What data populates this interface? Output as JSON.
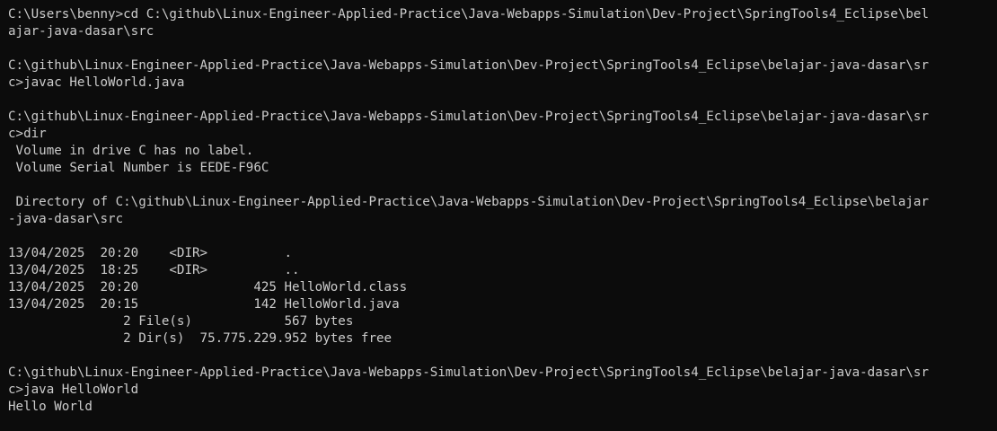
{
  "terminal": {
    "foreground": "#cccccc",
    "background": "#0c0c0c",
    "lines": [
      "C:\\Users\\benny>cd C:\\github\\Linux-Engineer-Applied-Practice\\Java-Webapps-Simulation\\Dev-Project\\SpringTools4_Eclipse\\bel",
      "ajar-java-dasar\\src",
      "",
      "C:\\github\\Linux-Engineer-Applied-Practice\\Java-Webapps-Simulation\\Dev-Project\\SpringTools4_Eclipse\\belajar-java-dasar\\sr",
      "c>javac HelloWorld.java",
      "",
      "C:\\github\\Linux-Engineer-Applied-Practice\\Java-Webapps-Simulation\\Dev-Project\\SpringTools4_Eclipse\\belajar-java-dasar\\sr",
      "c>dir",
      " Volume in drive C has no label.",
      " Volume Serial Number is EEDE-F96C",
      "",
      " Directory of C:\\github\\Linux-Engineer-Applied-Practice\\Java-Webapps-Simulation\\Dev-Project\\SpringTools4_Eclipse\\belajar",
      "-java-dasar\\src",
      "",
      "13/04/2025  20:20    <DIR>          .",
      "13/04/2025  18:25    <DIR>          ..",
      "13/04/2025  20:20               425 HelloWorld.class",
      "13/04/2025  20:15               142 HelloWorld.java",
      "               2 File(s)            567 bytes",
      "               2 Dir(s)  75.775.229.952 bytes free",
      "",
      "C:\\github\\Linux-Engineer-Applied-Practice\\Java-Webapps-Simulation\\Dev-Project\\SpringTools4_Eclipse\\belajar-java-dasar\\sr",
      "c>java HelloWorld",
      "Hello World"
    ]
  }
}
